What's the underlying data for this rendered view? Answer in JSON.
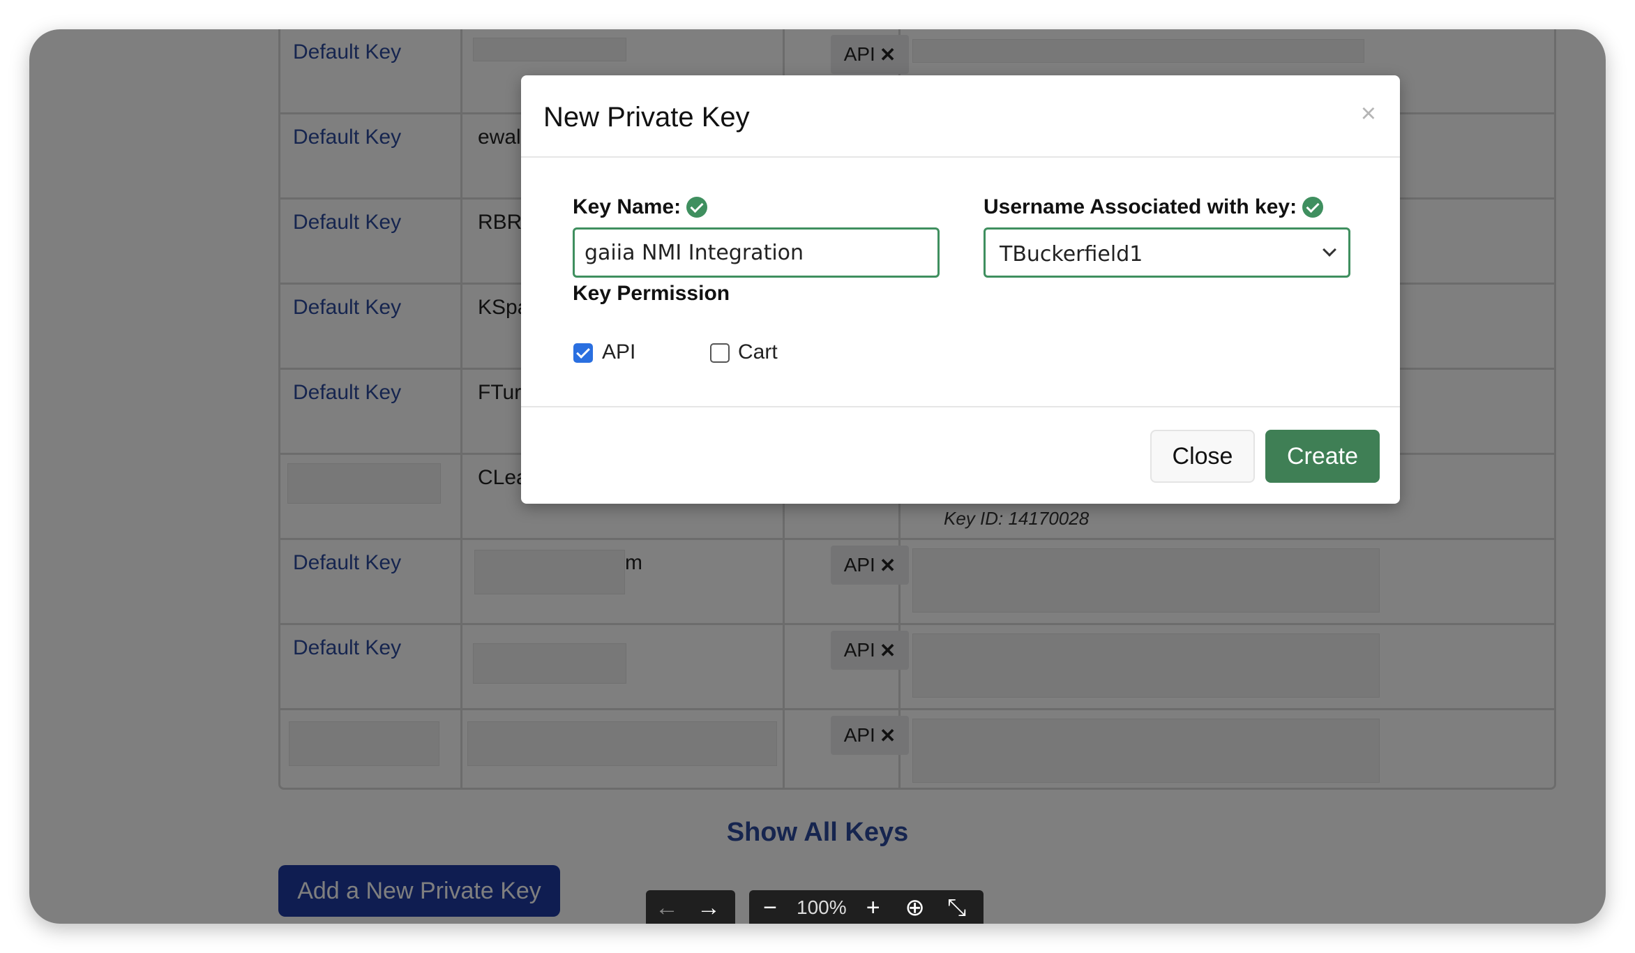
{
  "table": {
    "rows": [
      {
        "link": "Default Key",
        "text": "",
        "api_label": "API"
      },
      {
        "link": "Default Key",
        "text": "ewall",
        "api_label": ""
      },
      {
        "link": "Default Key",
        "text": "RBRU",
        "api_label": ""
      },
      {
        "link": "Default Key",
        "text": "KSpa",
        "api_label": ""
      },
      {
        "link": "Default Key",
        "text": "FTurs",
        "api_label": ""
      },
      {
        "link": "",
        "text": "CLea",
        "api_label": "",
        "note": "Key ID: 14170028"
      },
      {
        "link": "Default Key",
        "text": "m",
        "api_label": "API"
      },
      {
        "link": "Default Key",
        "text": "",
        "api_label": "API"
      },
      {
        "link": "",
        "text": "",
        "api_label": "API"
      }
    ],
    "remove_glyph": "✕"
  },
  "show_all_keys": "Show All Keys",
  "add_key_button": "Add a New Private Key",
  "viewer_toolbar": {
    "back_icon": "←",
    "forward_icon": "→",
    "zoom_out_icon": "−",
    "zoom_level": "100%",
    "zoom_in_icon": "+",
    "download_icon": "⊕",
    "collapse_icon": "⤡"
  },
  "modal": {
    "title": "New Private Key",
    "close_x": "×",
    "key_name_label": "Key Name:",
    "key_name_value": "gaiia NMI Integration",
    "username_label": "Username Associated with key:",
    "username_value": "TBuckerfield1",
    "permission_label": "Key Permission",
    "permissions": [
      {
        "label": "API",
        "checked": true
      },
      {
        "label": "Cart",
        "checked": false
      }
    ],
    "close_button": "Close",
    "create_button": "Create"
  },
  "colors": {
    "link": "#2c4a9e",
    "accent_green": "#3f7f55",
    "checkbox_blue": "#2a6fe0",
    "primary_blue": "#1e3aa3"
  }
}
